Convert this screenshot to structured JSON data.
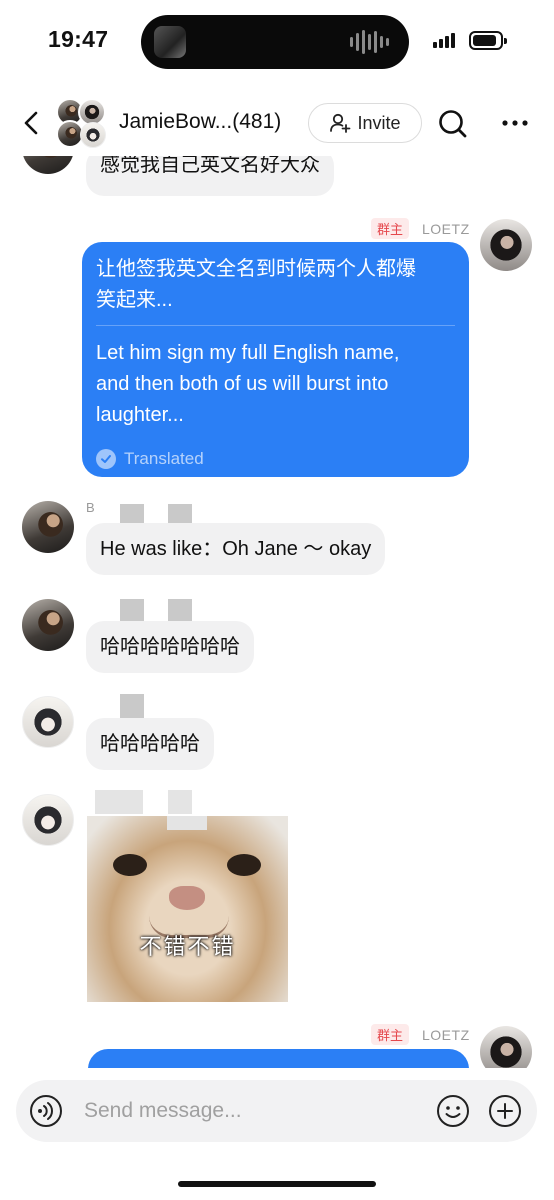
{
  "status_bar": {
    "time": "19:47"
  },
  "header": {
    "title": "JamieBow...(481)",
    "invite_label": "Invite",
    "icons": [
      "back-icon",
      "search-icon",
      "more-icon",
      "add-user-icon"
    ]
  },
  "messages": [
    {
      "text": "感觉我自己英文名好大众"
    },
    {
      "owner_badge": "群主",
      "sender": "LOETZ",
      "original": "让他签我英文全名到时候两个人都爆\n笑起来...",
      "translation": "Let him sign my full English name,\nand then both of us will burst into\nlaughter...",
      "translated_label": "Translated"
    },
    {
      "sender_initial": "B",
      "text": "He was like：Oh Jane ～ okay"
    },
    {
      "text": "哈哈哈哈哈哈哈"
    },
    {
      "text": "哈哈哈哈哈"
    },
    {
      "sticker_caption": "不错不错"
    },
    {
      "owner_badge": "群主",
      "sender": "LOETZ"
    }
  ],
  "composer": {
    "placeholder": "Send message..."
  }
}
